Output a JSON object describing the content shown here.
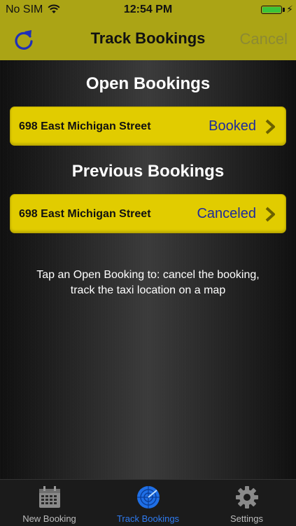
{
  "status_bar": {
    "carrier": "No SIM",
    "time": "12:54 PM"
  },
  "nav": {
    "title": "Track Bookings",
    "cancel_label": "Cancel",
    "refresh_icon": "refresh-icon"
  },
  "open_bookings": {
    "title": "Open Bookings",
    "items": [
      {
        "address": "698 East Michigan Street",
        "status": "Booked"
      }
    ]
  },
  "previous_bookings": {
    "title": "Previous Bookings",
    "items": [
      {
        "address": "698 East Michigan Street",
        "status": "Canceled"
      }
    ]
  },
  "hint": {
    "line1": "Tap an Open Booking to: cancel the booking,",
    "line2": "track the taxi location on a map"
  },
  "tabs": [
    {
      "label": "New Booking",
      "icon": "calendar-icon"
    },
    {
      "label": "Track Bookings",
      "icon": "radar-icon"
    },
    {
      "label": "Settings",
      "icon": "gear-icon"
    }
  ],
  "colors": {
    "nav_bg": "#aba415",
    "row_bg": "#e1cc00",
    "status_text": "#1d2a9e",
    "tab_active": "#2f7bf0"
  }
}
